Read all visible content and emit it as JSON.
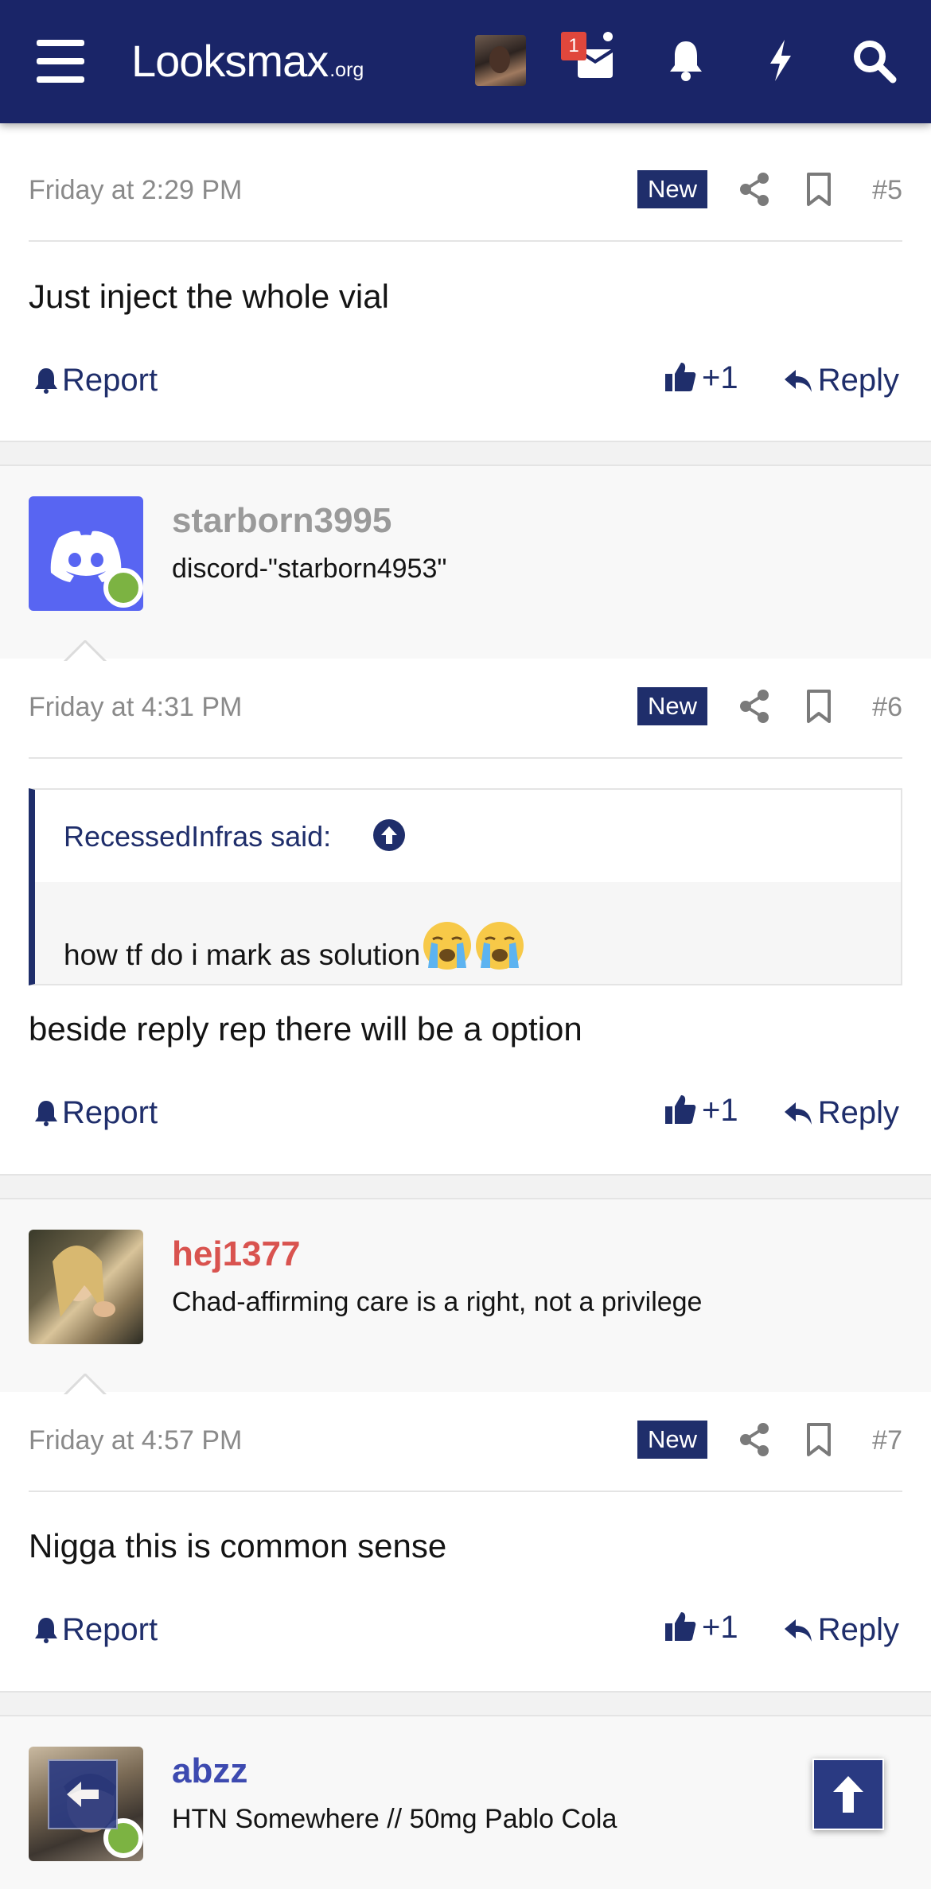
{
  "header": {
    "logo_text": "Looksmax",
    "logo_tld": ".org",
    "inbox_count": "1"
  },
  "posts": [
    {
      "date": "Friday at 2:29 PM",
      "new_label": "New",
      "number": "#5",
      "body": "Just inject the whole vial",
      "report_label": "Report",
      "reaction_count": "+1",
      "reply_label": "Reply"
    },
    {
      "date": "Friday at 4:31 PM",
      "new_label": "New",
      "number": "#6",
      "quote": {
        "author": "RecessedInfras said:",
        "text": "how tf do i mark as solution"
      },
      "body": "beside reply rep there will be a option",
      "report_label": "Report",
      "reaction_count": "+1",
      "reply_label": "Reply"
    },
    {
      "date": "Friday at 4:57 PM",
      "new_label": "New",
      "number": "#7",
      "body": "Nigga this is common sense",
      "report_label": "Report",
      "reaction_count": "+1",
      "reply_label": "Reply"
    }
  ],
  "users": [
    {
      "name": "starborn3995",
      "title": "discord-\"starborn4953\"",
      "name_color": "#9a9a9a"
    },
    {
      "name": "hej1377",
      "title": "Chad-affirming care is a right, not a privilege",
      "name_color": "#d9534f"
    },
    {
      "name": "abzz",
      "title": "HTN Somewhere // 50mg Pablo Cola",
      "name_color": "#3d4ab0"
    }
  ],
  "colors": {
    "header_bg": "#1a2568",
    "accent": "#1f2e6b",
    "online": "#7cb342"
  }
}
